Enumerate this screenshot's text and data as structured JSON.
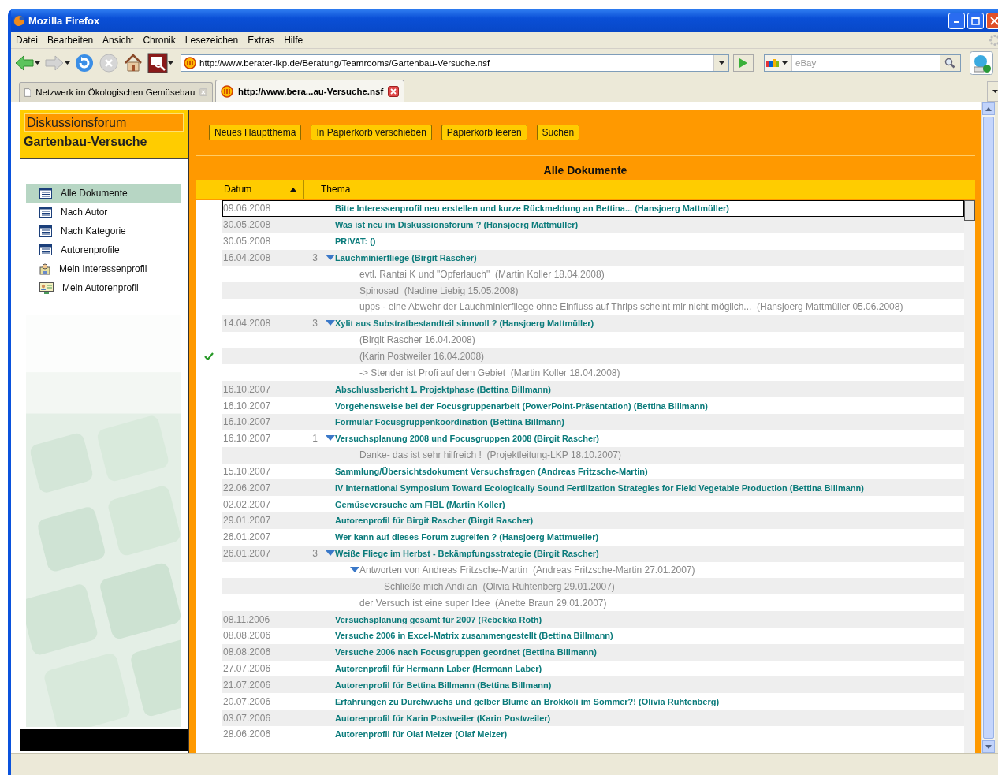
{
  "window": {
    "title": "Mozilla Firefox"
  },
  "menu": [
    "Datei",
    "Bearbeiten",
    "Ansicht",
    "Chronik",
    "Lesezeichen",
    "Extras",
    "Hilfe"
  ],
  "nav": [
    {
      "kind": "back",
      "disabled": false
    },
    {
      "kind": "forward",
      "disabled": true
    },
    {
      "kind": "reload",
      "disabled": false
    },
    {
      "kind": "stop",
      "disabled": true
    },
    {
      "kind": "home",
      "disabled": false
    }
  ],
  "address": {
    "url": "http://www.berater-lkp.de/Beratung/Teamrooms/Gartenbau-Versuche.nsf"
  },
  "search": {
    "placeholder": "eBay"
  },
  "tabs": [
    {
      "label": "Netzwerk im Ökologischen Gemüsebau",
      "selected": false
    },
    {
      "label": "http://www.bera...au-Versuche.nsf",
      "selected": true
    }
  ],
  "sidebar": {
    "forum_label": "Diskussionsforum",
    "forum_name": "Gartenbau-Versuche",
    "items": [
      {
        "label": "Alle Dokumente",
        "kind": "view",
        "selected": true
      },
      {
        "label": "Nach Autor",
        "kind": "view",
        "selected": false
      },
      {
        "label": "Nach Kategorie",
        "kind": "view",
        "selected": false
      },
      {
        "label": "Autorenprofile",
        "kind": "view",
        "selected": false
      },
      {
        "label": "Mein Interessenprofil",
        "kind": "interest",
        "selected": false
      },
      {
        "label": "Mein Autorenprofil",
        "kind": "profile",
        "selected": false
      }
    ]
  },
  "actions": [
    "Neues Hauptthema",
    "In Papierkorb verschieben",
    "Papierkorb leeren",
    "Suchen"
  ],
  "view_title": "Alle Dokumente",
  "columns": [
    {
      "label": "Datum",
      "sorted": true
    },
    {
      "label": "Thema",
      "sorted": false
    }
  ],
  "rows": [
    {
      "kind": "topic",
      "date": "09.06.2008",
      "title": "Bitte Interessenprofil neu erstellen und kurze Rückmeldung an Bettina... (Hansjoerg Mattmüller)",
      "selected": true,
      "checked": false,
      "expanded": false
    },
    {
      "kind": "topic",
      "date": "30.05.2008",
      "title": "Was ist neu im Diskussionsforum ? (Hansjoerg Mattmüller)",
      "selected": false,
      "checked": false,
      "expanded": false
    },
    {
      "kind": "topic",
      "date": "30.05.2008",
      "title": "PRIVAT:  ()",
      "selected": false,
      "checked": false,
      "expanded": false
    },
    {
      "kind": "topic",
      "date": "16.04.2008",
      "count": "3",
      "title": "Lauchminierfliege (Birgit Rascher)",
      "selected": false,
      "checked": false,
      "expanded": true,
      "children": [
        {
          "kind": "reply",
          "text": "evtl. Rantai K und \"Opferlauch\"  (Martin Koller 18.04.2008)",
          "selected": false,
          "checked": false,
          "expanded": false
        },
        {
          "kind": "reply",
          "text": "Spinosad  (Nadine Liebig 15.05.2008)",
          "selected": false,
          "checked": false,
          "expanded": false
        },
        {
          "kind": "reply",
          "text": "upps - eine Abwehr der Lauchminierfliege ohne Einfluss auf Thrips scheint mir nicht möglich...  (Hansjoerg Mattmüller 05.06.2008)",
          "selected": false,
          "checked": false,
          "expanded": false
        }
      ]
    },
    {
      "kind": "topic",
      "date": "14.04.2008",
      "count": "3",
      "title": "Xylit aus Substratbestandteil sinnvoll ? (Hansjoerg Mattmüller)",
      "selected": false,
      "checked": false,
      "expanded": true,
      "children": [
        {
          "kind": "reply",
          "text": "(Birgit Rascher 16.04.2008)",
          "selected": false,
          "checked": false,
          "expanded": false
        },
        {
          "kind": "reply",
          "text": "(Karin Postweiler 16.04.2008)",
          "selected": false,
          "checked": true,
          "expanded": false
        },
        {
          "kind": "reply",
          "text": "-> Stender ist Profi auf dem Gebiet  (Martin Koller 18.04.2008)",
          "selected": false,
          "checked": false,
          "expanded": false
        }
      ]
    },
    {
      "kind": "topic",
      "date": "16.10.2007",
      "title": "Abschlussbericht 1. Projektphase (Bettina Billmann)",
      "selected": false,
      "checked": false,
      "expanded": false
    },
    {
      "kind": "topic",
      "date": "16.10.2007",
      "title": "Vorgehensweise bei der Focusgruppenarbeit (PowerPoint-Präsentation) (Bettina Billmann)",
      "selected": false,
      "checked": false,
      "expanded": false
    },
    {
      "kind": "topic",
      "date": "16.10.2007",
      "title": "Formular Focusgruppenkoordination (Bettina Billmann)",
      "selected": false,
      "checked": false,
      "expanded": false
    },
    {
      "kind": "topic",
      "date": "16.10.2007",
      "count": "1",
      "title": "Versuchsplanung 2008 und Focusgruppen 2008 (Birgit Rascher)",
      "selected": false,
      "checked": false,
      "expanded": true,
      "children": [
        {
          "kind": "reply",
          "text": "Danke- das ist sehr hilfreich !  (Projektleitung-LKP 18.10.2007)",
          "selected": false,
          "checked": false,
          "expanded": false
        }
      ]
    },
    {
      "kind": "topic",
      "date": "15.10.2007",
      "title": "Sammlung/Übersichtsdokument Versuchsfragen (Andreas Fritzsche-Martin)",
      "selected": false,
      "checked": false,
      "expanded": false
    },
    {
      "kind": "topic",
      "date": "22.06.2007",
      "title": "IV International Symposium Toward Ecologically Sound Fertilization Strategies for Field Vegetable Production (Bettina Billmann)",
      "selected": false,
      "checked": false,
      "expanded": false
    },
    {
      "kind": "topic",
      "date": "02.02.2007",
      "title": "Gemüseversuche am FIBL (Martin Koller)",
      "selected": false,
      "checked": false,
      "expanded": false
    },
    {
      "kind": "topic",
      "date": "29.01.2007",
      "title": "Autorenprofil für Birgit Rascher (Birgit Rascher)",
      "selected": false,
      "checked": false,
      "expanded": false
    },
    {
      "kind": "topic",
      "date": "26.01.2007",
      "title": "Wer kann auf dieses Forum zugreifen ? (Hansjoerg Mattmueller)",
      "selected": false,
      "checked": false,
      "expanded": false
    },
    {
      "kind": "topic",
      "date": "26.01.2007",
      "count": "3",
      "title": "Weiße Fliege im Herbst - Bekämpfungsstrategie (Birgit Rascher)",
      "selected": false,
      "checked": false,
      "expanded": true,
      "children": [
        {
          "kind": "reply",
          "text": "Antworten von Andreas Fritzsche-Martin  (Andreas Fritzsche-Martin 27.01.2007)",
          "selected": false,
          "checked": false,
          "expanded": true,
          "children": [
            {
              "kind": "reply",
              "text": "Schließe mich Andi an  (Olivia Ruhtenberg 29.01.2007)",
              "selected": false,
              "checked": false,
              "expanded": false
            }
          ]
        },
        {
          "kind": "reply",
          "text": "der Versuch ist eine super Idee  (Anette Braun 29.01.2007)",
          "selected": false,
          "checked": false,
          "expanded": false
        }
      ]
    },
    {
      "kind": "topic",
      "date": "08.11.2006",
      "title": "Versuchsplanung gesamt für 2007 (Rebekka Roth)",
      "selected": false,
      "checked": false,
      "expanded": false
    },
    {
      "kind": "topic",
      "date": "08.08.2006",
      "title": "Versuche 2006 in Excel-Matrix zusammengestellt (Bettina Billmann)",
      "selected": false,
      "checked": false,
      "expanded": false
    },
    {
      "kind": "topic",
      "date": "08.08.2006",
      "title": "Versuche 2006 nach Focusgruppen geordnet (Bettina Billmann)",
      "selected": false,
      "checked": false,
      "expanded": false
    },
    {
      "kind": "topic",
      "date": "27.07.2006",
      "title": "Autorenprofil für Hermann Laber (Hermann Laber)",
      "selected": false,
      "checked": false,
      "expanded": false
    },
    {
      "kind": "topic",
      "date": "21.07.2006",
      "title": "Autorenprofil für Bettina Billmann (Bettina Billmann)",
      "selected": false,
      "checked": false,
      "expanded": false
    },
    {
      "kind": "topic",
      "date": "20.07.2006",
      "title": "Erfahrungen zu Durchwuchs und gelber Blume an Brokkoli im Sommer?! (Olivia Ruhtenberg)",
      "selected": false,
      "checked": false,
      "expanded": false
    },
    {
      "kind": "topic",
      "date": "03.07.2006",
      "title": "Autorenprofil für Karin Postweiler (Karin Postweiler)",
      "selected": false,
      "checked": false,
      "expanded": false
    },
    {
      "kind": "topic",
      "date": "28.06.2006",
      "title": "Autorenprofil für Olaf Melzer (Olaf Melzer)",
      "selected": false,
      "checked": false,
      "expanded": false
    }
  ]
}
